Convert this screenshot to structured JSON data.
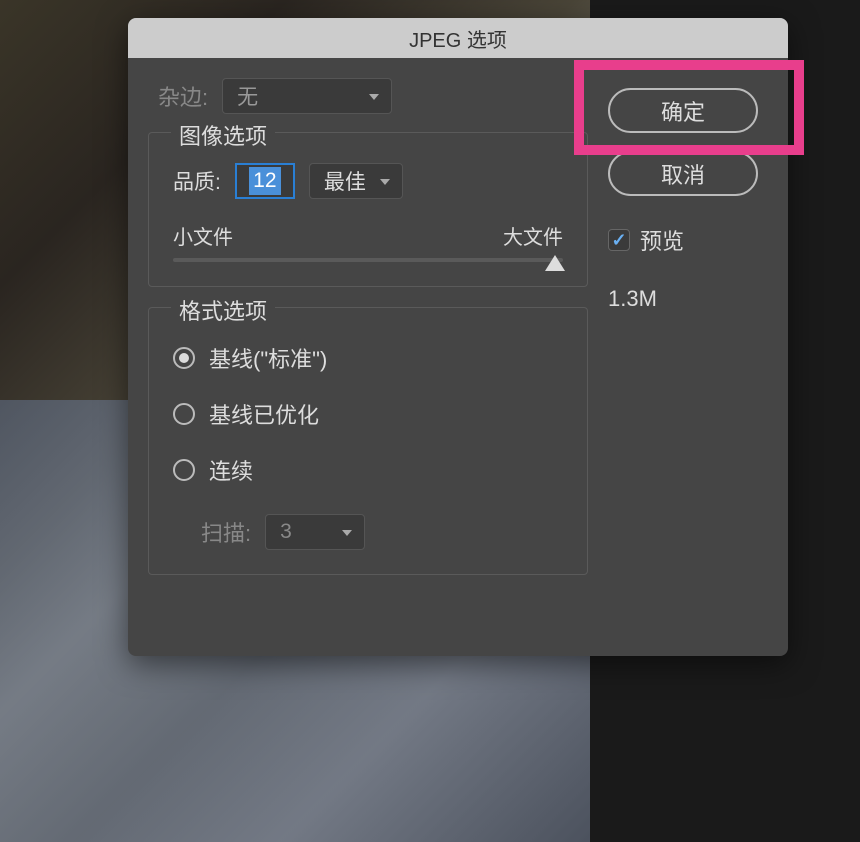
{
  "dialog": {
    "title": "JPEG 选项",
    "matte": {
      "label": "杂边:",
      "value": "无"
    },
    "imageOptions": {
      "legend": "图像选项",
      "qualityLabel": "品质:",
      "qualityValue": "12",
      "qualityPreset": "最佳",
      "sliderLeft": "小文件",
      "sliderRight": "大文件"
    },
    "formatOptions": {
      "legend": "格式选项",
      "radios": [
        {
          "label": "基线(\"标准\")",
          "checked": true
        },
        {
          "label": "基线已优化",
          "checked": false
        },
        {
          "label": "连续",
          "checked": false
        }
      ],
      "scanLabel": "扫描:",
      "scanValue": "3"
    },
    "buttons": {
      "ok": "确定",
      "cancel": "取消"
    },
    "preview": {
      "label": "预览",
      "checked": true
    },
    "filesize": "1.3M"
  }
}
